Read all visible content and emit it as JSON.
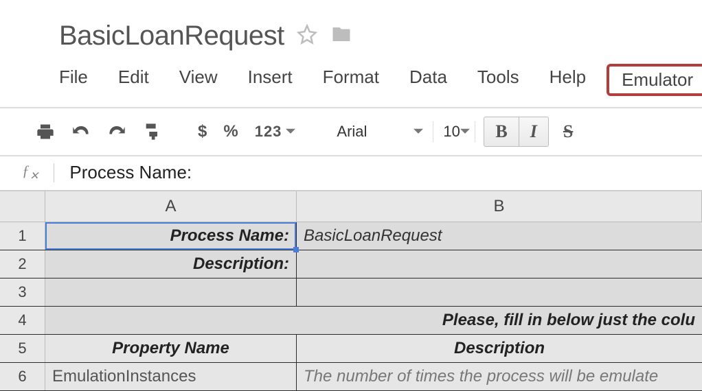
{
  "doc": {
    "title": "BasicLoanRequest"
  },
  "menu": {
    "file": "File",
    "edit": "Edit",
    "view": "View",
    "insert": "Insert",
    "format": "Format",
    "data": "Data",
    "tools": "Tools",
    "help": "Help",
    "emulator": "Emulator"
  },
  "toolbar": {
    "currency": "$",
    "percent": "%",
    "number": "123",
    "font": "Arial",
    "size": "10",
    "bold": "B",
    "italic": "I",
    "strike": "S"
  },
  "formula_bar": {
    "label": "ƒ",
    "sub": "✕",
    "content": "Process Name:"
  },
  "columns": {
    "A": "A",
    "B": "B"
  },
  "rows": [
    {
      "num": "1",
      "A": "Process Name:",
      "B": "BasicLoanRequest",
      "styleA": "bold-italic",
      "styleB": "italic",
      "selected": true
    },
    {
      "num": "2",
      "A": "Description:",
      "B": "",
      "styleA": "bold-italic",
      "styleB": ""
    },
    {
      "num": "3",
      "A": "",
      "B": ""
    },
    {
      "num": "4",
      "A": "",
      "B": "Please, fill in below just the colu",
      "styleB": "bold-italic",
      "merged": true,
      "alignB": "right"
    },
    {
      "num": "5",
      "A": "Property Name",
      "B": "Description",
      "styleA": "bold-italic",
      "styleB": "bold-italic",
      "alignA": "center",
      "alignB": "center",
      "light": true
    },
    {
      "num": "6",
      "A": "EmulationInstances",
      "B": "The number of times the process will be emulate",
      "styleA": "plain-left",
      "styleB": "gray-text",
      "light": true
    }
  ]
}
